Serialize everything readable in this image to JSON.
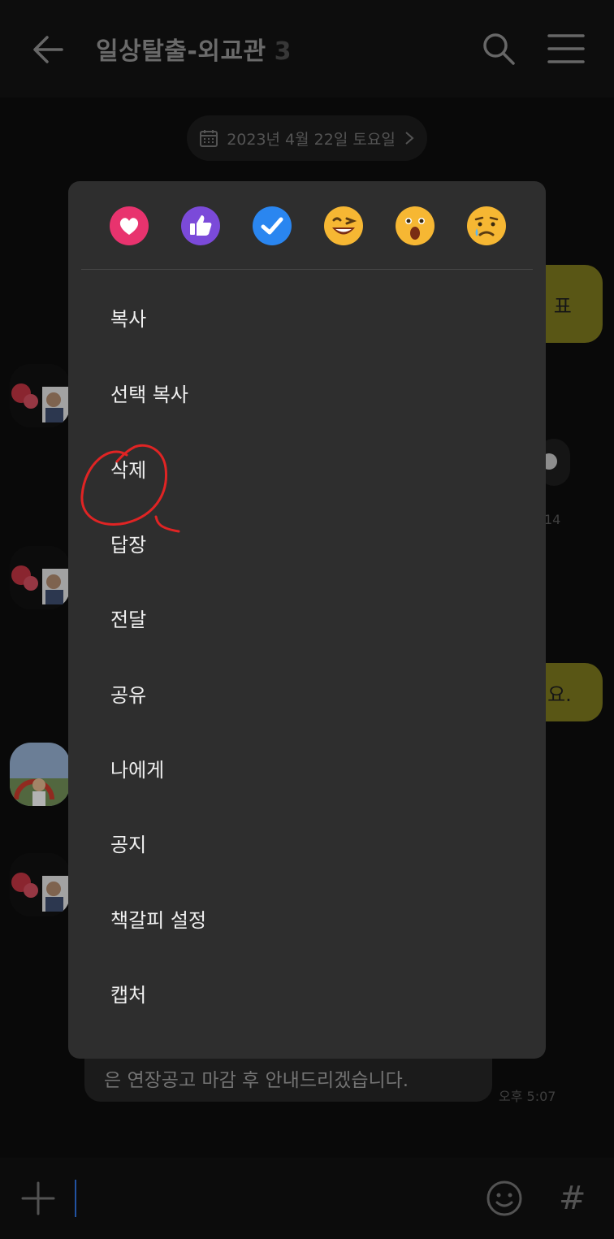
{
  "header": {
    "title": "일상탈출-외교관",
    "member_count": "3"
  },
  "date_divider": {
    "label": "2023년 4월 22일 토요일"
  },
  "chat": {
    "bubble_1_partial": "림 표",
    "bubble_2_partial": "뵈요.",
    "timestamp_partial": "14",
    "bottom_message_partial": "은 연장공고 마감 후 안내드리겠습니다.",
    "bottom_time": "오후 5:07"
  },
  "reactions": [
    {
      "name": "heart",
      "color": "#e8336e"
    },
    {
      "name": "thumbs-up",
      "color": "#7b4ad9"
    },
    {
      "name": "check",
      "color": "#2a86f0"
    },
    {
      "name": "laughing-face",
      "color": "#f6b733"
    },
    {
      "name": "surprised-face",
      "color": "#f6b733"
    },
    {
      "name": "sad-face",
      "color": "#f6b733"
    }
  ],
  "context_menu": {
    "items": [
      {
        "label": "복사"
      },
      {
        "label": "선택 복사"
      },
      {
        "label": "삭제"
      },
      {
        "label": "답장"
      },
      {
        "label": "전달"
      },
      {
        "label": "공유"
      },
      {
        "label": "나에게"
      },
      {
        "label": "공지"
      },
      {
        "label": "책갈피 설정"
      },
      {
        "label": "캡처"
      }
    ]
  },
  "colors": {
    "accent_yellow": "#77731c",
    "annotation_red": "#e02424",
    "caret_blue": "#2e6fd8"
  }
}
